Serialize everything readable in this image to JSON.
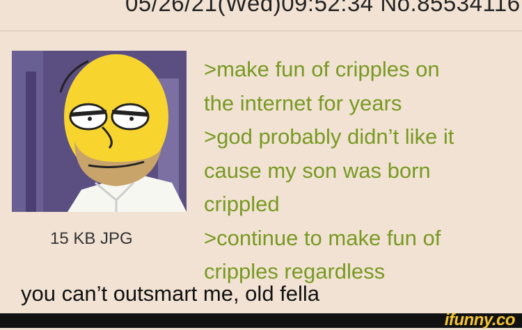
{
  "post": {
    "header": "05/26/21(Wed)09:52:34 No.85534116",
    "file_info": "15 KB JPG",
    "greentext": [
      ">make fun of cripples on",
      "the internet for years",
      ">god probably didn’t like it",
      "cause my son was born",
      "crippled",
      ">continue to make fun of",
      "cripples regardless"
    ],
    "text": "you can’t outsmart me, old fella"
  },
  "watermark": "ifunny.co"
}
